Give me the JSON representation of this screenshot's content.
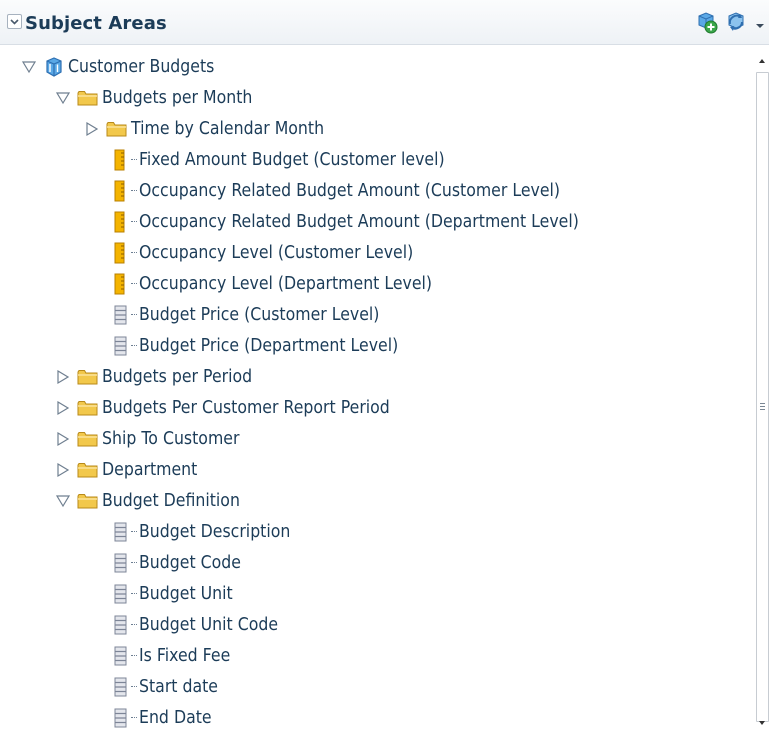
{
  "header": {
    "title": "Subject Areas",
    "collapse_icon": "chevron-down-icon",
    "add_icon": "add-subject-area-icon",
    "refresh_icon": "refresh-icon",
    "menu_icon": "dropdown-arrow-icon"
  },
  "colors": {
    "text": "#1c3c58",
    "folder": "#f2c84b",
    "measure": "#f4b400",
    "attribute": "#8d95a6",
    "cube": "#3b8fd6"
  },
  "tree": [
    {
      "label": "Customer Budgets",
      "type": "subject",
      "level": 0,
      "toggle": "expanded"
    },
    {
      "label": "Budgets per Month",
      "type": "folder",
      "level": 1,
      "toggle": "expanded"
    },
    {
      "label": "Time by Calendar Month",
      "type": "folder",
      "level": 2,
      "toggle": "collapsed"
    },
    {
      "label": "Fixed Amount Budget (Customer level)",
      "type": "measure",
      "level": 3
    },
    {
      "label": "Occupancy Related Budget Amount (Customer Level)",
      "type": "measure",
      "level": 3
    },
    {
      "label": "Occupancy Related Budget Amount (Department Level)",
      "type": "measure",
      "level": 3
    },
    {
      "label": "Occupancy Level (Customer Level)",
      "type": "measure",
      "level": 3
    },
    {
      "label": "Occupancy Level (Department Level)",
      "type": "measure",
      "level": 3
    },
    {
      "label": "Budget Price (Customer Level)",
      "type": "attribute",
      "level": 3
    },
    {
      "label": "Budget Price (Department Level)",
      "type": "attribute",
      "level": 3
    },
    {
      "label": "Budgets per Period",
      "type": "folder",
      "level": 1,
      "toggle": "collapsed"
    },
    {
      "label": "Budgets Per Customer Report Period",
      "type": "folder",
      "level": 1,
      "toggle": "collapsed"
    },
    {
      "label": "Ship To Customer",
      "type": "folder",
      "level": 1,
      "toggle": "collapsed"
    },
    {
      "label": "Department",
      "type": "folder",
      "level": 1,
      "toggle": "collapsed"
    },
    {
      "label": "Budget Definition",
      "type": "folder",
      "level": 1,
      "toggle": "expanded"
    },
    {
      "label": "Budget Description",
      "type": "attribute",
      "level": 3
    },
    {
      "label": "Budget Code",
      "type": "attribute",
      "level": 3
    },
    {
      "label": "Budget Unit",
      "type": "attribute",
      "level": 3
    },
    {
      "label": "Budget Unit Code",
      "type": "attribute",
      "level": 3
    },
    {
      "label": "Is Fixed Fee",
      "type": "attribute",
      "level": 3
    },
    {
      "label": "Start date",
      "type": "attribute",
      "level": 3
    },
    {
      "label": "End Date",
      "type": "attribute",
      "level": 3
    }
  ]
}
